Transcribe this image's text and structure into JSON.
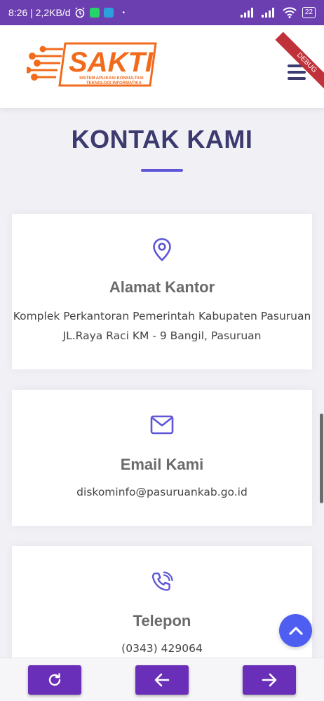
{
  "status_bar": {
    "time_speed": "8:26 | 2,2KB/d",
    "battery": "22"
  },
  "header": {
    "logo_text": "SAKTI",
    "logo_subtitle_1": "SISTEM APLIKASI KONSULTASI",
    "logo_subtitle_2": "TEKNOLOGI INFORMATIKA",
    "debug_label": "DEBUG"
  },
  "section": {
    "title": "KONTAK KAMI"
  },
  "cards": {
    "alamat": {
      "icon": "map-pin-icon",
      "title": "Alamat Kantor",
      "line1": "Komplek Perkantoran Pemerintah Kabupaten Pasuruan",
      "line2": "JL.Raya Raci KM - 9 Bangil, Pasuruan"
    },
    "email": {
      "icon": "envelope-icon",
      "title": "Email Kami",
      "line1": "diskominfo@pasuruankab.go.id"
    },
    "telepon": {
      "icon": "phone-icon",
      "title": "Telepon",
      "line1": "(0343) 429064"
    }
  },
  "colors": {
    "primary": "#3c3a6e",
    "accent": "#5e56d6",
    "nav_button": "#6a2fb8",
    "scroll_top": "#4d5ef0",
    "logo_orange": "#f26b1d"
  }
}
